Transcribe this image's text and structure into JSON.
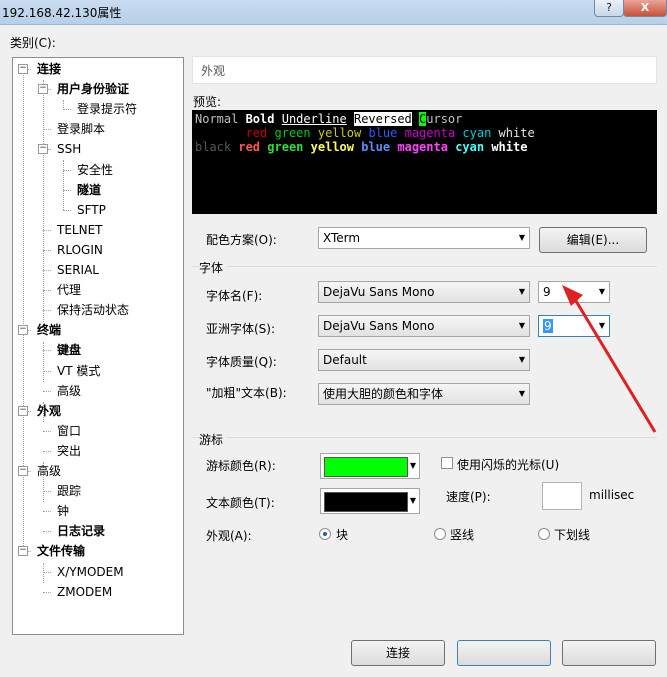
{
  "window": {
    "title": "192.168.42.130属性",
    "help": "?",
    "close": "X"
  },
  "category_label": "类别(C):",
  "tree": [
    {
      "label": "连接",
      "bold": true
    },
    {
      "label": "用户身份验证",
      "bold": true
    },
    {
      "label": "登录提示符",
      "bold": false
    },
    {
      "label": "登录脚本",
      "bold": false
    },
    {
      "label": "SSH",
      "bold": false
    },
    {
      "label": "安全性",
      "bold": false
    },
    {
      "label": "隧道",
      "bold": true
    },
    {
      "label": "SFTP",
      "bold": false
    },
    {
      "label": "TELNET",
      "bold": false
    },
    {
      "label": "RLOGIN",
      "bold": false
    },
    {
      "label": "SERIAL",
      "bold": false
    },
    {
      "label": "代理",
      "bold": false
    },
    {
      "label": "保持活动状态",
      "bold": false
    },
    {
      "label": "终端",
      "bold": true
    },
    {
      "label": "键盘",
      "bold": true
    },
    {
      "label": "VT 模式",
      "bold": false
    },
    {
      "label": "高级",
      "bold": false
    },
    {
      "label": "外观",
      "bold": true
    },
    {
      "label": "窗口",
      "bold": false
    },
    {
      "label": "突出",
      "bold": false
    },
    {
      "label": "高级",
      "bold": false
    },
    {
      "label": "跟踪",
      "bold": false
    },
    {
      "label": "钟",
      "bold": false
    },
    {
      "label": "日志记录",
      "bold": true
    },
    {
      "label": "文件传输",
      "bold": true
    },
    {
      "label": "X/YMODEM",
      "bold": false
    },
    {
      "label": "ZMODEM",
      "bold": false
    }
  ],
  "panel_header": "外观",
  "preview_label": "预览:",
  "preview": {
    "line1": {
      "normal": "Normal ",
      "bold": "Bold",
      "underline": "Underline",
      "reversed": "Reversed",
      "cursor_char": "C",
      "cursor_rest": "ursor"
    },
    "line2": {
      "red": "red",
      "green": "green",
      "yellow": "yellow",
      "blue": "blue",
      "magenta": "magenta",
      "cyan": "cyan",
      "white": "white"
    },
    "line3": {
      "black": "black",
      "red": "red",
      "green": "green",
      "yellow": "yellow",
      "blue": "blue",
      "magenta": "magenta",
      "cyan": "cyan",
      "white": "white"
    }
  },
  "color_scheme": {
    "label": "配色方案(O):",
    "value": "XTerm",
    "edit_button": "编辑(E)..."
  },
  "font_group": {
    "title": "字体",
    "font_name_label": "字体名(F):",
    "font_name": "DejaVu Sans Mono",
    "font_size": "9",
    "asian_font_label": "亚洲字体(S):",
    "asian_font": "DejaVu Sans Mono",
    "asian_size": "9",
    "quality_label": "字体质量(Q):",
    "quality": "Default",
    "bold_label": "\"加粗\"文本(B):",
    "bold_value": "使用大胆的颜色和字体"
  },
  "cursor_group": {
    "title": "游标",
    "cursor_color_label": "游标颜色(R):",
    "blink_label": "使用闪烁的光标(U)",
    "text_color_label": "文本颜色(T):",
    "speed_label": "速度(P):",
    "speed_unit": "millisec",
    "appearance_label": "外观(A):",
    "shape_block": "块",
    "shape_line": "竖线",
    "shape_underline": "下划线"
  },
  "colors": {
    "cursor_color": "#00ff00",
    "text_color": "#000000",
    "red": "#ff5555",
    "green": "#33dd33",
    "yellow": "#ffff55",
    "blue": "#5c8cff",
    "magenta": "#ff44ff",
    "cyan": "#44ffff",
    "dim_red": "#cd0000",
    "dim_green": "#00cd00",
    "dim_yellow": "#cdcd00",
    "dim_blue": "#2b5bff",
    "dim_magenta": "#cd00cd",
    "dim_cyan": "#00cdcd"
  },
  "buttons": {
    "connect": "连接",
    "ok": "",
    "cancel": ""
  }
}
